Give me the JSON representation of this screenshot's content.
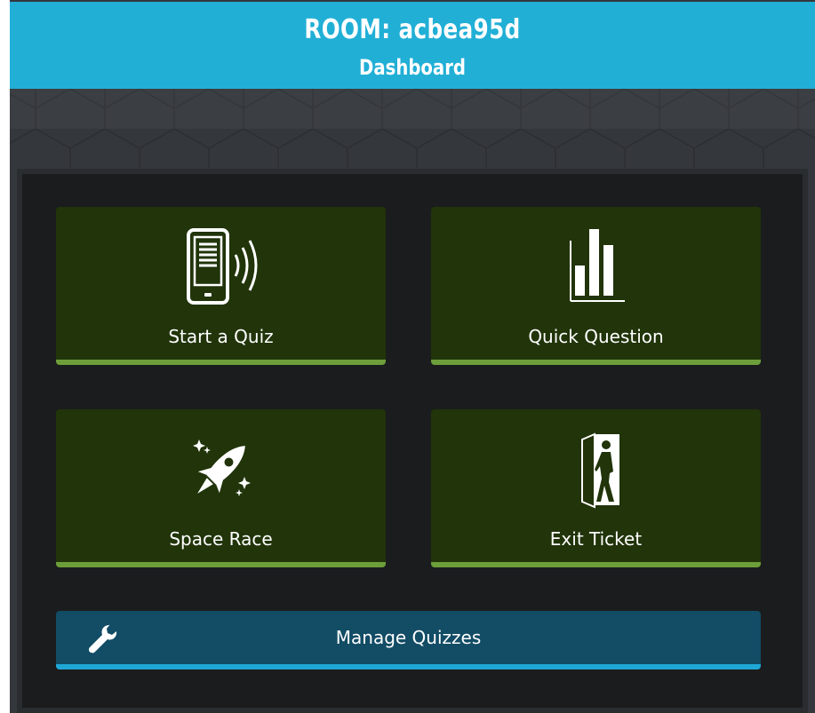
{
  "header": {
    "room_title": "ROOM: acbea95d",
    "page_title": "Dashboard",
    "color": "#21afd6"
  },
  "tiles": [
    {
      "label": "Start a Quiz",
      "icon": "tablet-signal-icon"
    },
    {
      "label": "Quick Question",
      "icon": "bar-chart-icon"
    },
    {
      "label": "Space Race",
      "icon": "rocket-icon"
    },
    {
      "label": "Exit Ticket",
      "icon": "exit-door-icon"
    }
  ],
  "manage": {
    "label": "Manage Quizzes",
    "icon": "wrench-icon"
  },
  "colors": {
    "tile_bg": "#21340a",
    "tile_accent": "#6d9e3a",
    "manage_bg": "#124c65",
    "manage_accent": "#1fa7d6",
    "panel_bg": "#1b1c1d"
  }
}
